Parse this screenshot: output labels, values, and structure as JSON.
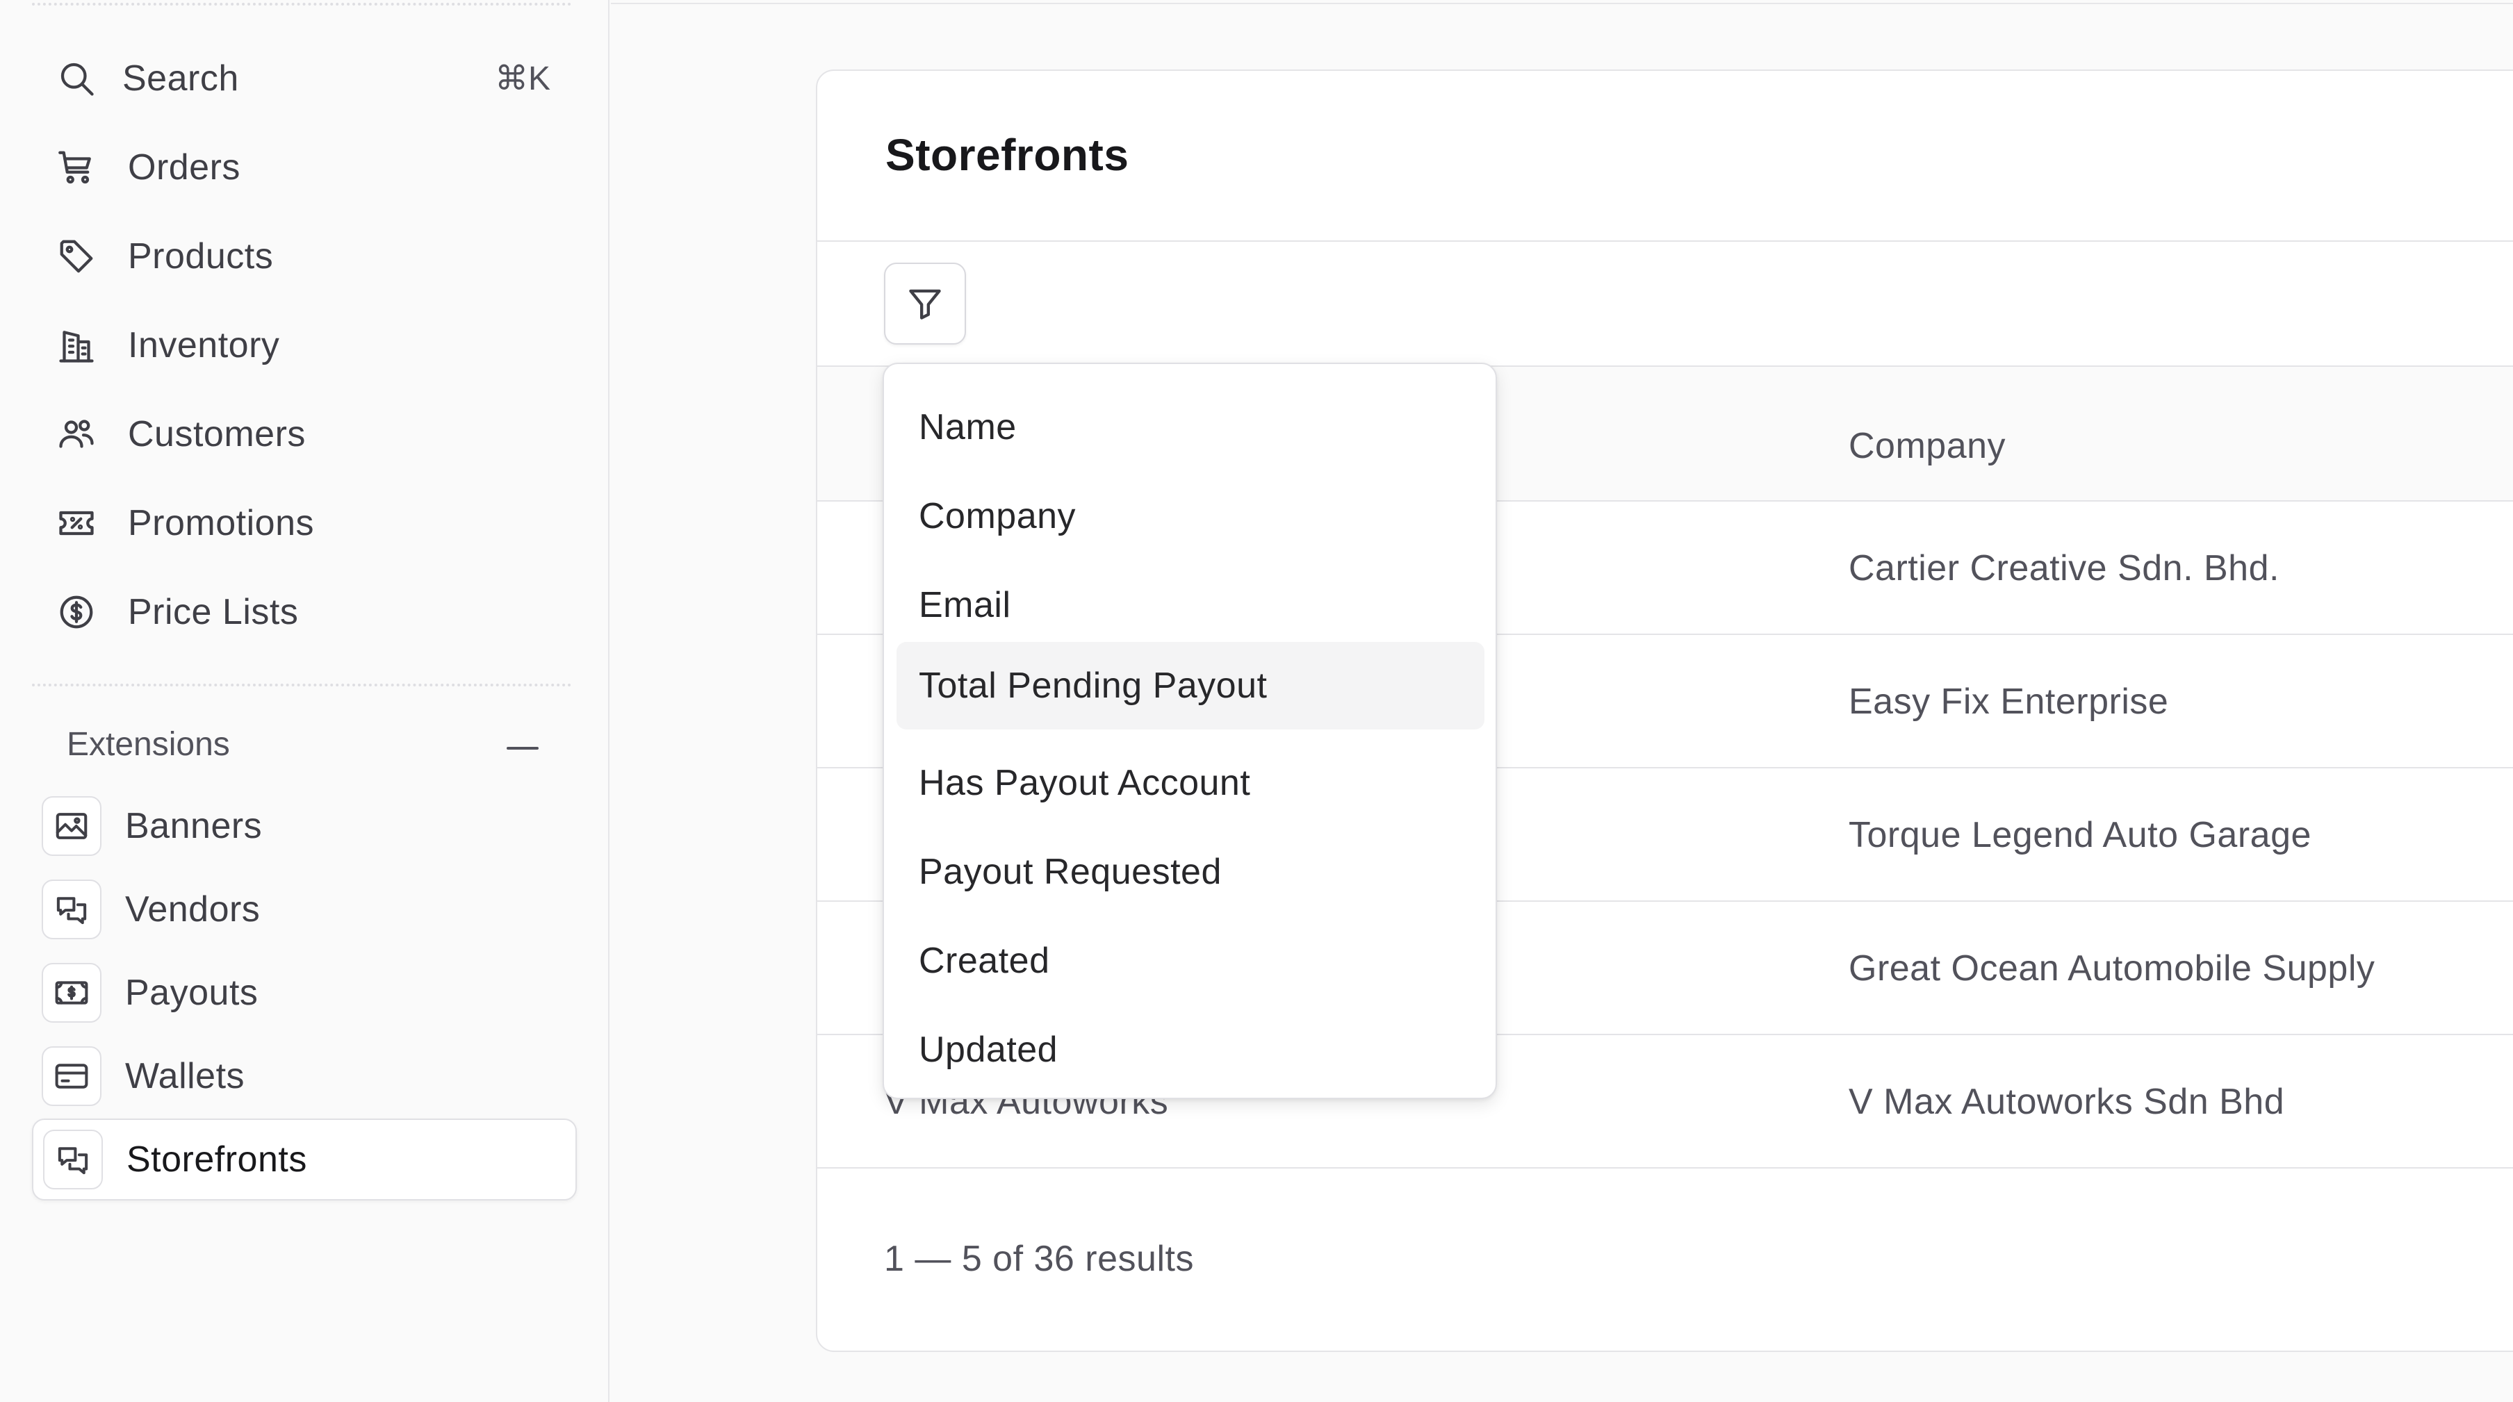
{
  "sidebar": {
    "search": {
      "label": "Search",
      "shortcut": "⌘K",
      "icon": "search-icon"
    },
    "nav": [
      {
        "label": "Orders",
        "icon": "cart-icon"
      },
      {
        "label": "Products",
        "icon": "tag-icon"
      },
      {
        "label": "Inventory",
        "icon": "building-icon"
      },
      {
        "label": "Customers",
        "icon": "users-icon"
      },
      {
        "label": "Promotions",
        "icon": "receipt-percent-icon"
      },
      {
        "label": "Price Lists",
        "icon": "currency-dollar-icon"
      }
    ],
    "extensions_title": "Extensions",
    "extensions": [
      {
        "label": "Banners",
        "icon": "photo-icon"
      },
      {
        "label": "Vendors",
        "icon": "chat-bubbles-icon"
      },
      {
        "label": "Payouts",
        "icon": "cash-icon"
      },
      {
        "label": "Wallets",
        "icon": "credit-card-icon"
      },
      {
        "label": "Storefronts",
        "icon": "chat-bubbles-icon",
        "active": true
      }
    ]
  },
  "main": {
    "title": "Storefronts",
    "filter_icon": "funnel-icon",
    "columns": {
      "company": "Company"
    },
    "rows": [
      {
        "company": "Cartier Creative Sdn. Bhd."
      },
      {
        "company": "Easy Fix Enterprise"
      },
      {
        "company": "Torque Legend Auto Garage"
      },
      {
        "company": "Great Ocean Automobile Supply"
      },
      {
        "name": "V Max Autoworks",
        "company": "V Max Autoworks Sdn Bhd"
      }
    ],
    "results": "1 — 5 of 36 results"
  },
  "filter_menu": {
    "options": [
      "Name",
      "Company",
      "Email",
      "Total Pending Payout",
      "Has Payout Account",
      "Payout Requested",
      "Created",
      "Updated"
    ],
    "highlighted": "Total Pending Payout"
  },
  "colors": {
    "background": "#fafafa",
    "card": "#ffffff",
    "border": "#e4e4e7",
    "text": "#3f3f46"
  }
}
